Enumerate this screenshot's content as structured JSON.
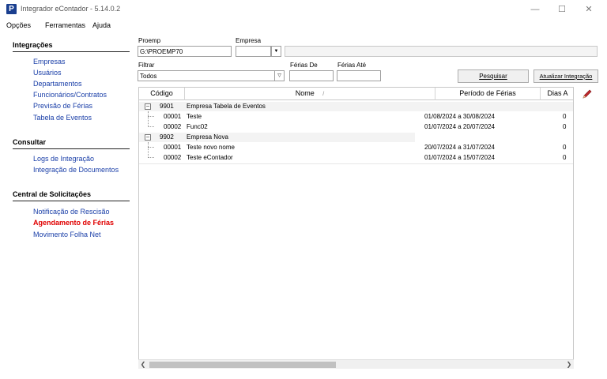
{
  "window": {
    "title": "Integrador eContador - 5.14.0.2",
    "app_icon_letter": "P",
    "minimize": "—",
    "maximize": "☐",
    "close": "✕"
  },
  "menu": [
    "Opções",
    "Ferramentas",
    "Ajuda"
  ],
  "sidebar": {
    "sections": [
      {
        "title": "Integrações",
        "items": [
          "Empresas",
          "Usuários",
          "Departamentos",
          "Funcionários/Contratos",
          "Previsão de Férias",
          "Tabela de Eventos"
        ]
      },
      {
        "title": "Consultar",
        "items": [
          "Logs de Integração",
          "Integração de Documentos"
        ]
      },
      {
        "title": "Central de Solicitações",
        "items": [
          "Notificação de Rescisão",
          "Agendamento de Férias",
          "Movimento Folha Net"
        ]
      }
    ],
    "active_item": "Agendamento de Férias"
  },
  "form": {
    "proemp_label": "Proemp",
    "proemp_value": "G:\\PROEMP70",
    "empresa_label": "Empresa",
    "empresa_value": "",
    "filtrar_label": "Filtrar",
    "filtrar_value": "Todos",
    "ferias_de_label": "Férias De",
    "ferias_de_value": "",
    "ferias_ate_label": "Férias Até",
    "ferias_ate_value": "",
    "pesquisar_label": "Pesquisar",
    "atualizar_label": "Atualizar Integração"
  },
  "grid": {
    "columns": [
      "Código",
      "Nome",
      "Período de Férias",
      "Dias A"
    ],
    "sort_indicator": "/",
    "groups": [
      {
        "code": "9901",
        "name": "Empresa Tabela de Eventos",
        "rows": [
          {
            "code": "00001",
            "name": "Teste",
            "period": "01/08/2024 a 30/08/2024",
            "days": "0"
          },
          {
            "code": "00002",
            "name": "Func02",
            "period": "01/07/2024 a 20/07/2024",
            "days": "0"
          }
        ]
      },
      {
        "code": "9902",
        "name": "Empresa Nova",
        "rows": [
          {
            "code": "00001",
            "name": "Teste novo nome",
            "period": "20/07/2024 a 31/07/2024",
            "days": "0"
          },
          {
            "code": "00002",
            "name": "Teste eContador",
            "period": "01/07/2024 a 15/07/2024",
            "days": "0"
          }
        ]
      }
    ]
  },
  "colors": {
    "link": "#1a3fa8",
    "active_link": "#e00000",
    "app_icon": "#1a3f8f",
    "edit_icon": "#c0282d"
  }
}
